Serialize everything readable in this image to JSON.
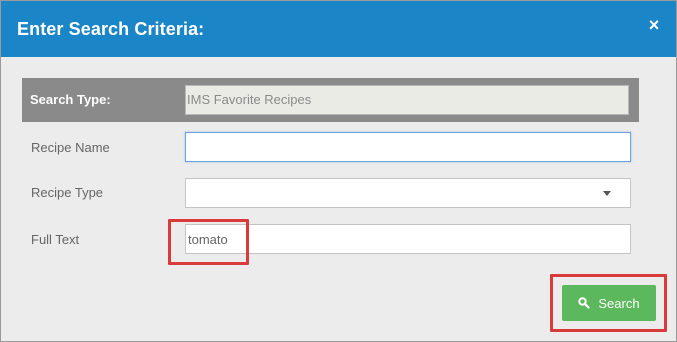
{
  "dialog": {
    "title": "Enter Search Criteria:",
    "close_icon": "×"
  },
  "search_type": {
    "label": "Search Type:",
    "value": "IMS Favorite Recipes"
  },
  "fields": {
    "recipe_name": {
      "label": "Recipe Name",
      "value": ""
    },
    "recipe_type": {
      "label": "Recipe Type",
      "value": ""
    },
    "full_text": {
      "label": "Full Text",
      "value": "tomato"
    }
  },
  "search_button": {
    "label": "Search",
    "icon": "search-icon"
  },
  "colors": {
    "title_bar": "#1a86c8",
    "search_type_bar": "#8a8a8a",
    "search_button": "#5cb85c",
    "highlight": "#d93a3a"
  }
}
